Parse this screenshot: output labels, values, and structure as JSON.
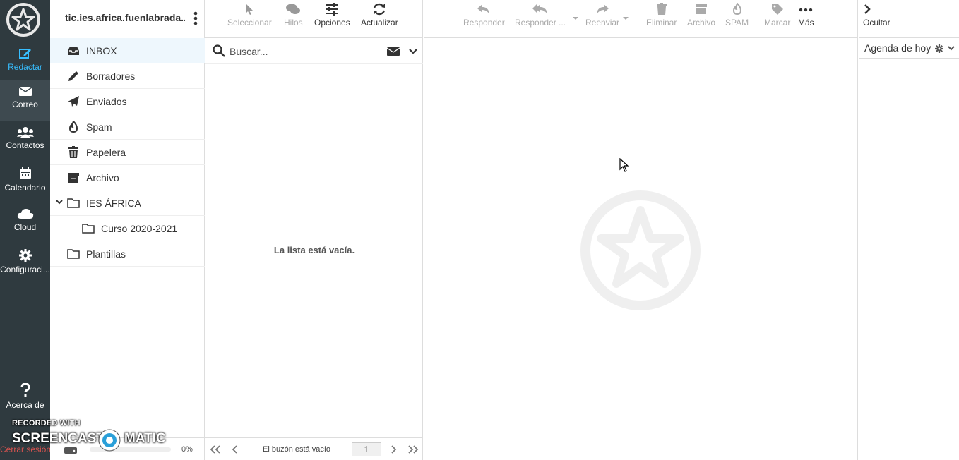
{
  "nav": {
    "compose": "Redactar",
    "mail": "Correo",
    "contacts": "Contactos",
    "calendar": "Calendario",
    "cloud": "Cloud",
    "settings": "Configuraci...",
    "about": "Acerca de",
    "logout": "Cerrar sesión"
  },
  "account": {
    "name": "tic.ies.africa.fuenlabrada..."
  },
  "folders": [
    {
      "name": "INBOX",
      "icon": "inbox-icon"
    },
    {
      "name": "Borradores",
      "icon": "pencil-icon"
    },
    {
      "name": "Enviados",
      "icon": "paper-plane-icon"
    },
    {
      "name": "Spam",
      "icon": "fire-icon"
    },
    {
      "name": "Papelera",
      "icon": "trash-icon"
    },
    {
      "name": "Archivo",
      "icon": "archive-icon"
    },
    {
      "name": "IES ÁFRICA",
      "icon": "folder-icon"
    },
    {
      "name": "Curso 2020-2021",
      "icon": "folder-icon"
    },
    {
      "name": "Plantillas",
      "icon": "folder-icon"
    }
  ],
  "quota": {
    "percent": "0%"
  },
  "list_toolbar": {
    "select": "Seleccionar",
    "threads": "Hilos",
    "options": "Opciones",
    "refresh": "Actualizar"
  },
  "search": {
    "placeholder": "Buscar..."
  },
  "list": {
    "empty": "La lista está vacía."
  },
  "pager": {
    "status": "El buzón está vacío",
    "page": "1"
  },
  "message_toolbar": {
    "reply": "Responder",
    "reply_all": "Responder ...",
    "forward": "Reenviar",
    "delete": "Eliminar",
    "archive": "Archivo",
    "spam": "SPAM",
    "mark": "Marcar",
    "more": "Más"
  },
  "sidebar": {
    "hide": "Ocultar",
    "agenda": "Agenda de hoy"
  },
  "overlay": {
    "recorded_with": "RECORDED WITH",
    "brand_left": "SCREENCAST",
    "brand_right": "MATIC"
  },
  "colors": {
    "nav_bg": "#2f3a3f",
    "accent": "#37beff",
    "selected_folder": "#eef7fd",
    "logout": "#d9534f"
  }
}
